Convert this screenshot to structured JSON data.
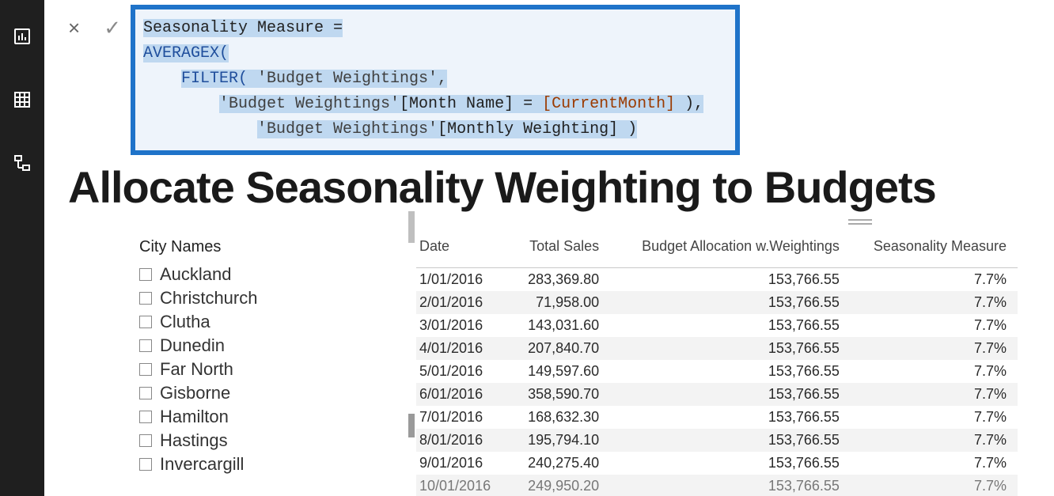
{
  "formula": {
    "line1_measure": "Seasonality Measure =",
    "line2_func": "AVERAGEX(",
    "line3_func": "FILTER(",
    "line3_table": " 'Budget Weightings',",
    "line4_table": "'Budget Weightings'",
    "line4_col": "[Month Name]",
    "line4_eq": " = ",
    "line4_measure": "[CurrentMonth]",
    "line4_close": " ),",
    "line5_table": "'Budget Weightings'",
    "line5_col": "[Monthly Weighting]",
    "line5_close": " )"
  },
  "page_title": "Allocate Seasonality Weighting to Budgets",
  "slicer": {
    "title": "City Names",
    "items": [
      "Auckland",
      "Christchurch",
      "Clutha",
      "Dunedin",
      "Far North",
      "Gisborne",
      "Hamilton",
      "Hastings",
      "Invercargill"
    ]
  },
  "table": {
    "headers": {
      "date": "Date",
      "total_sales": "Total Sales",
      "budget_alloc": "Budget Allocation w.Weightings",
      "seasonality": "Seasonality Measure"
    },
    "rows": [
      {
        "date": "1/01/2016",
        "total_sales": "283,369.80",
        "budget": "153,766.55",
        "season": "7.7%"
      },
      {
        "date": "2/01/2016",
        "total_sales": "71,958.00",
        "budget": "153,766.55",
        "season": "7.7%"
      },
      {
        "date": "3/01/2016",
        "total_sales": "143,031.60",
        "budget": "153,766.55",
        "season": "7.7%"
      },
      {
        "date": "4/01/2016",
        "total_sales": "207,840.70",
        "budget": "153,766.55",
        "season": "7.7%"
      },
      {
        "date": "5/01/2016",
        "total_sales": "149,597.60",
        "budget": "153,766.55",
        "season": "7.7%"
      },
      {
        "date": "6/01/2016",
        "total_sales": "358,590.70",
        "budget": "153,766.55",
        "season": "7.7%"
      },
      {
        "date": "7/01/2016",
        "total_sales": "168,632.30",
        "budget": "153,766.55",
        "season": "7.7%"
      },
      {
        "date": "8/01/2016",
        "total_sales": "195,794.10",
        "budget": "153,766.55",
        "season": "7.7%"
      },
      {
        "date": "9/01/2016",
        "total_sales": "240,275.40",
        "budget": "153,766.55",
        "season": "7.7%"
      },
      {
        "date": "10/01/2016",
        "total_sales": "249,950.20",
        "budget": "153,766.55",
        "season": "7.7%"
      }
    ]
  },
  "icons": {
    "report": "report-icon",
    "data": "data-icon",
    "model": "model-icon",
    "cancel": "×",
    "commit": "✓"
  }
}
